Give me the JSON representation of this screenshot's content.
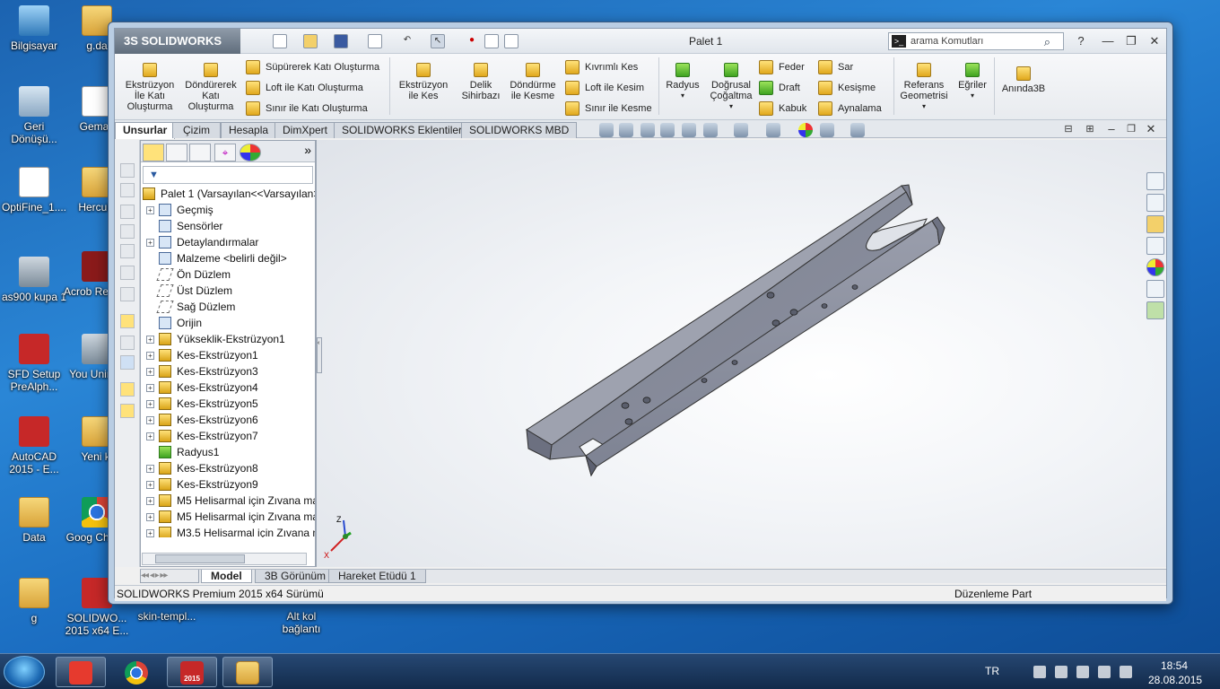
{
  "desktop": {
    "icons": [
      {
        "label": "Bilgisayar"
      },
      {
        "label": "g.da"
      },
      {
        "label": "Geri Dönüşü..."
      },
      {
        "label": "Gemas"
      },
      {
        "label": "OptiFine_1...."
      },
      {
        "label": "HercuLi"
      },
      {
        "label": "as900 kupa 1"
      },
      {
        "label": "Acrob Reader"
      },
      {
        "label": "SFD Setup PreAlph..."
      },
      {
        "label": "You Unin-st"
      },
      {
        "label": "AutoCAD 2015 - E..."
      },
      {
        "label": "Yeni kl"
      },
      {
        "label": "Data"
      },
      {
        "label": "Goog Chrom"
      },
      {
        "label": "g"
      },
      {
        "label": "SOLIDWO... 2015 x64 E..."
      },
      {
        "label": "skin-templ..."
      },
      {
        "label": "Alt kol bağlantı"
      }
    ]
  },
  "app": {
    "brand": "3S SOLIDWORKS",
    "document_title": "Palet 1",
    "search_placeholder": "arama Komutları",
    "help_label": "?"
  },
  "ribbon": {
    "big": [
      {
        "label": "Ekstrüzyon İle Katı Oluşturma"
      },
      {
        "label": "Döndürerek Katı Oluşturma"
      },
      {
        "label": "Ekstrüzyon ile Kes"
      },
      {
        "label": "Delik Sihirbazı"
      },
      {
        "label": "Döndürme ile Kesme"
      },
      {
        "label": "Radyus"
      },
      {
        "label": "Doğrusal Çoğaltma"
      },
      {
        "label": "Referans Geometrisi"
      },
      {
        "label": "Eğriler"
      },
      {
        "label": "Anında3B"
      }
    ],
    "small": [
      {
        "label": "Süpürerek Katı Oluşturma"
      },
      {
        "label": "Loft ile Katı Oluşturma"
      },
      {
        "label": "Sınır ile Katı Oluşturma"
      },
      {
        "label": "Kıvrımlı Kes"
      },
      {
        "label": "Loft ile Kesim"
      },
      {
        "label": "Sınır ile Kesme"
      },
      {
        "label": "Feder"
      },
      {
        "label": "Draft"
      },
      {
        "label": "Kabuk"
      },
      {
        "label": "Sar"
      },
      {
        "label": "Kesişme"
      },
      {
        "label": "Aynalama"
      }
    ]
  },
  "tabs": [
    {
      "label": "Unsurlar"
    },
    {
      "label": "Çizim"
    },
    {
      "label": "Hesapla"
    },
    {
      "label": "DimXpert"
    },
    {
      "label": "SOLIDWORKS Eklentileri"
    },
    {
      "label": "SOLIDWORKS MBD"
    }
  ],
  "tree": {
    "filter_icon": "filter-icon",
    "root": "Palet 1  (Varsayılan<<Varsayılan>",
    "items": [
      {
        "label": "Geçmiş"
      },
      {
        "label": "Sensörler"
      },
      {
        "label": "Detaylandırmalar"
      },
      {
        "label": "Malzeme <belirli değil>"
      },
      {
        "label": "Ön Düzlem"
      },
      {
        "label": "Üst Düzlem"
      },
      {
        "label": "Sağ Düzlem"
      },
      {
        "label": "Orijin"
      },
      {
        "label": "Yükseklik-Ekstrüzyon1"
      },
      {
        "label": "Kes-Ekstrüzyon1"
      },
      {
        "label": "Kes-Ekstrüzyon3"
      },
      {
        "label": "Kes-Ekstrüzyon4"
      },
      {
        "label": "Kes-Ekstrüzyon5"
      },
      {
        "label": "Kes-Ekstrüzyon6"
      },
      {
        "label": "Kes-Ekstrüzyon7"
      },
      {
        "label": "Radyus1"
      },
      {
        "label": "Kes-Ekstrüzyon8"
      },
      {
        "label": "Kes-Ekstrüzyon9"
      },
      {
        "label": "M5 Helisarmal için Zıvana ma"
      },
      {
        "label": "M5 Helisarmal için Zıvana ma"
      },
      {
        "label": "M3.5 Helisarmal için Zıvana n"
      }
    ]
  },
  "bottom_tabs": [
    {
      "label": "Model"
    },
    {
      "label": "3B Görünüm"
    },
    {
      "label": "Hareket Etüdü 1"
    }
  ],
  "status": {
    "left": "SOLIDWORKS Premium 2015 x64 Sürümü",
    "right": "Düzenleme Part"
  },
  "triad": {
    "z": "Z",
    "x": "X"
  },
  "taskbar": {
    "lang": "TR",
    "time": "18:54",
    "date": "28.08.2015",
    "sw_badge": "2015"
  },
  "colors": {
    "part": "#8a8e9e",
    "accent": "#1d6ab4"
  }
}
